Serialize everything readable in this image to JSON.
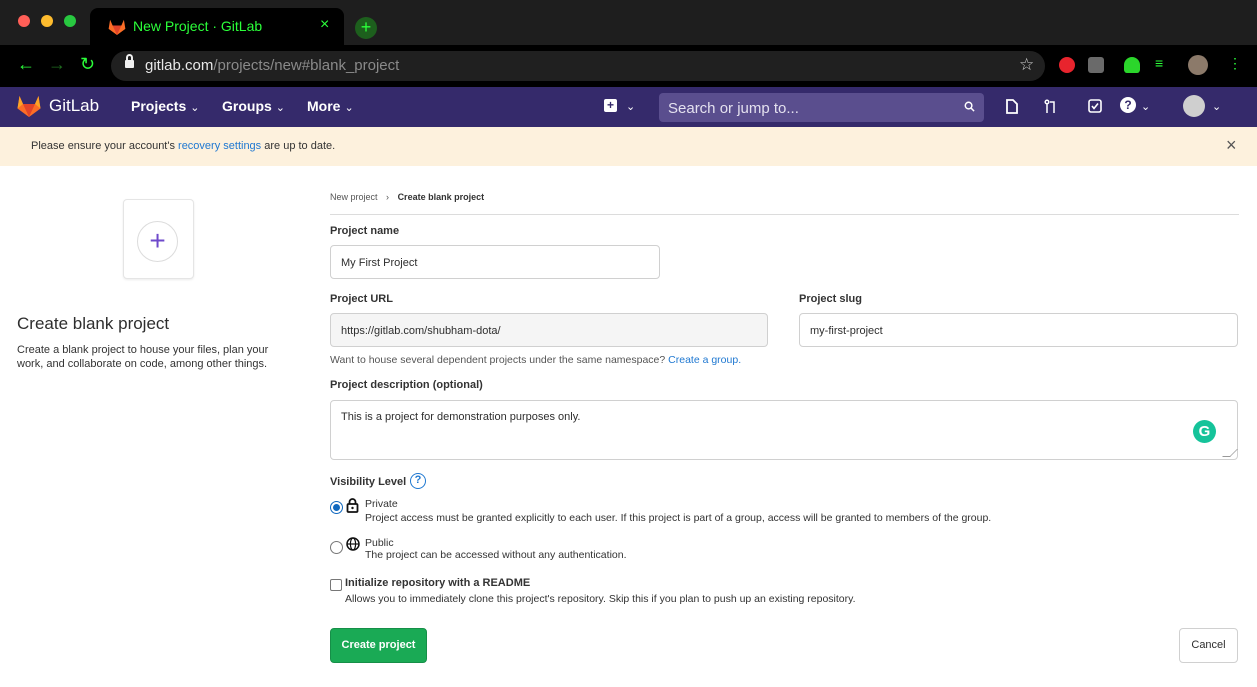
{
  "browser": {
    "tab_title": "New Project · GitLab",
    "tab_close": "×",
    "new_tab": "+",
    "url_host": "gitlab.com",
    "url_path": "/projects/new#blank_project",
    "back_icon": "arrow-left-icon",
    "forward_icon": "arrow-right-icon",
    "reload_icon": "reload-icon"
  },
  "gitlab_nav": {
    "brand": "GitLab",
    "menus": [
      "Projects",
      "Groups",
      "More"
    ],
    "search_placeholder": "Search or jump to...",
    "plus_glyph": "+",
    "caret": "⌄"
  },
  "banner": {
    "prefix": "Please ensure your account's ",
    "link": "recovery settings",
    "suffix": " are up to date.",
    "close": "×"
  },
  "left": {
    "tile_plus": "+",
    "title": "Create blank project",
    "description": "Create a blank project to house your files, plan your work, and collaborate on code, among other things."
  },
  "breadcrumb": {
    "first": "New project",
    "separator": "›",
    "current": "Create blank project"
  },
  "form": {
    "project_name_label": "Project name",
    "project_name_value": "My First Project",
    "project_url_label": "Project URL",
    "project_url_value": "https://gitlab.com/shubham-dota/",
    "project_slug_label": "Project slug",
    "project_slug_value": "my-first-project",
    "group_help_prefix": "Want to house several dependent projects under the same namespace? ",
    "group_help_link": "Create a group.",
    "description_label": "Project description (optional)",
    "description_value": "This is a project for demonstration purposes only.",
    "grammarly_glyph": "G",
    "visibility_label": "Visibility Level",
    "help_glyph": "?",
    "private_title": "Private",
    "private_desc": "Project access must be granted explicitly to each user. If this project is part of a group, access will be granted to members of the group.",
    "public_title": "Public",
    "public_desc": "The project can be accessed without any authentication.",
    "readme_label": "Initialize repository with a README",
    "readme_desc": "Allows you to immediately clone this project's repository. Skip this if you plan to push up an existing repository.",
    "create_button": "Create project",
    "cancel_button": "Cancel"
  },
  "colors": {
    "navbar": "#352a6b",
    "banner": "#fdf1dd",
    "primary": "#1aaa55",
    "link": "#1f78d1"
  }
}
